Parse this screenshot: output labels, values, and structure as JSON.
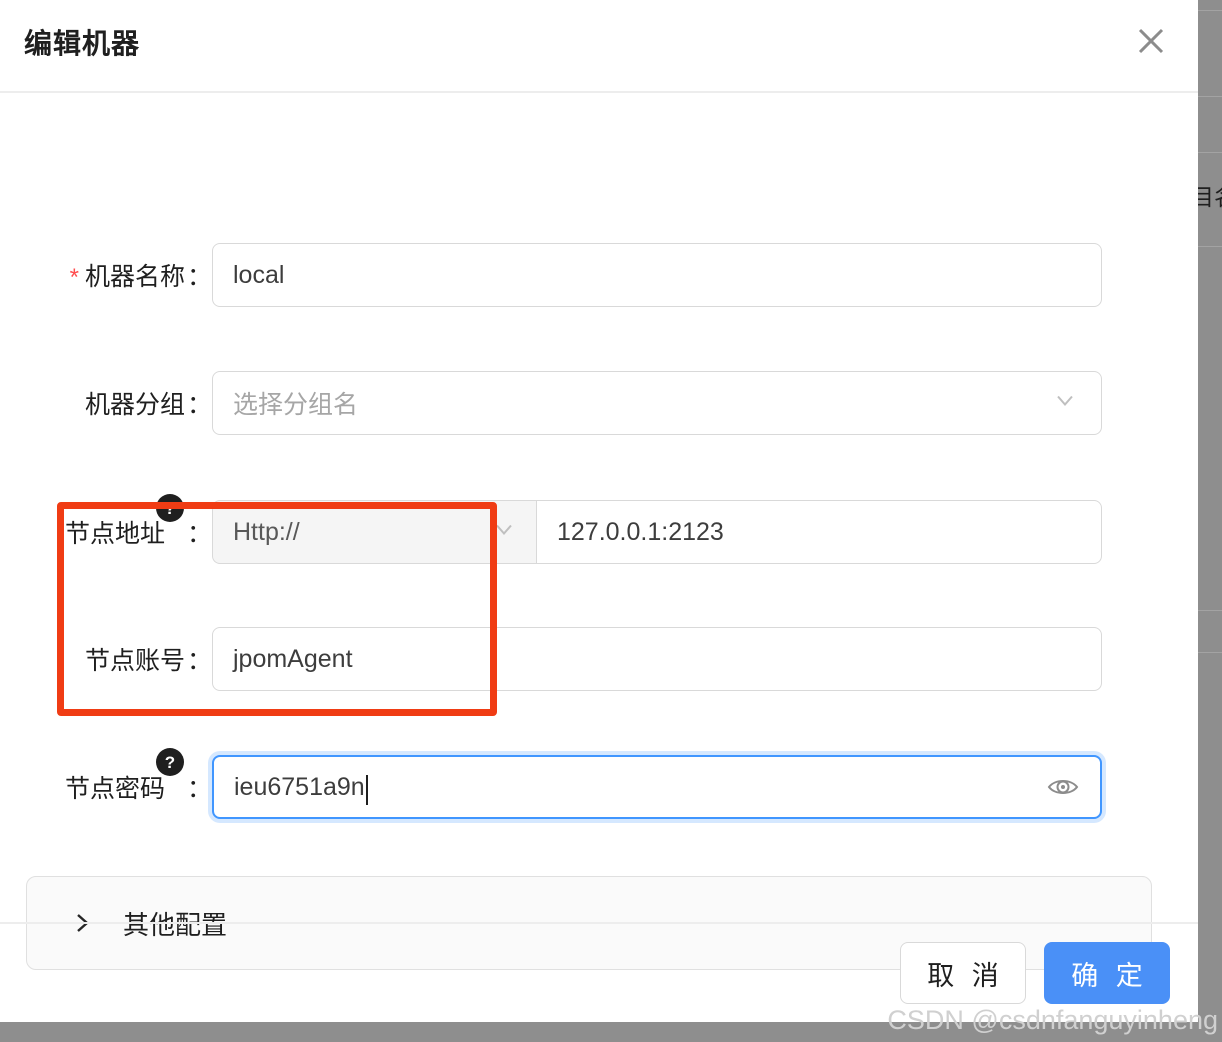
{
  "modal": {
    "title": "编辑机器",
    "close_icon": "close-icon"
  },
  "form": {
    "machine_name": {
      "label": "机器名称",
      "colon": "：",
      "required_marker": "*",
      "value": "local"
    },
    "machine_group": {
      "label": "机器分组",
      "colon": "：",
      "placeholder": "选择分组名",
      "dropdown_icon": "chevron-down-icon"
    },
    "node_address": {
      "label": "节点地址",
      "colon": "：",
      "help_icon": "question-circle-icon",
      "help_glyph": "?",
      "protocol": "Http://",
      "protocol_icon": "chevron-down-icon",
      "value": "127.0.0.1:2123"
    },
    "node_account": {
      "label": "节点账号",
      "colon": "：",
      "value": "jpomAgent"
    },
    "node_password": {
      "label": "节点密码",
      "colon": "：",
      "help_icon": "question-circle-icon",
      "help_glyph": "?",
      "value": "ieu6751a9n",
      "reveal_icon": "eye-icon"
    }
  },
  "collapse": {
    "title": "其他配置",
    "icon": "chevron-right-icon",
    "expanded": false
  },
  "footer": {
    "cancel_label": "取 消",
    "confirm_label": "确 定"
  },
  "annotation": {
    "color": "#f03c14",
    "shape": "rectangle"
  },
  "watermark": {
    "text": "CSDN @csdnfanguyinheng"
  },
  "background": {
    "partial_text": "目名"
  },
  "colors": {
    "primary": "#4a90f7",
    "focus_border": "#4096ff",
    "required": "#ff4d4f",
    "annotation": "#f03c14",
    "panel": "#fafafa",
    "border": "#d9d9d9"
  }
}
